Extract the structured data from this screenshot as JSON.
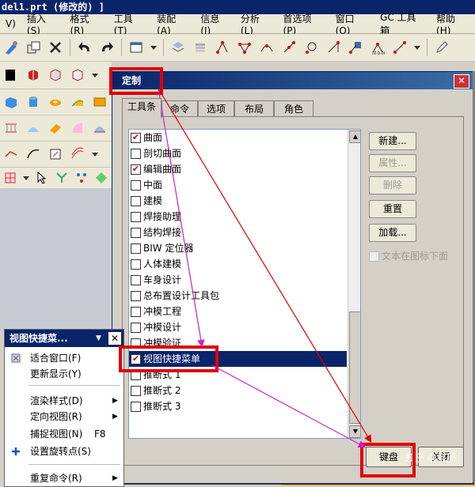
{
  "window": {
    "title": "del1.prt  (修改的) ]"
  },
  "menu": [
    "V)",
    "插入(S)",
    "格式(R)",
    "工具(T)",
    "装配(A)",
    "信息(I)",
    "分析(L)",
    "首选项(P)",
    "窗口(O)",
    "GC 工具箱",
    "帮助(H)"
  ],
  "dialog": {
    "title": "定制",
    "close_label": "✕",
    "tabs": [
      "工具条",
      "命令",
      "选项",
      "布局",
      "角色"
    ],
    "items": [
      {
        "label": "曲面",
        "checked": true
      },
      {
        "label": "剖切曲面",
        "checked": false
      },
      {
        "label": "编辑曲面",
        "checked": true
      },
      {
        "label": "中面",
        "checked": false
      },
      {
        "label": "建模",
        "checked": false
      },
      {
        "label": "焊接助理",
        "checked": false
      },
      {
        "label": "结构焊接",
        "checked": false
      },
      {
        "label": "BIW 定位器",
        "checked": false
      },
      {
        "label": "人体建模",
        "checked": false
      },
      {
        "label": "车身设计",
        "checked": false
      },
      {
        "label": "总布置设计工具包",
        "checked": false
      },
      {
        "label": "冲模工程",
        "checked": false
      },
      {
        "label": "冲模设计",
        "checked": false
      },
      {
        "label": "冲模验证",
        "checked": false
      },
      {
        "label": "视图快捷菜单",
        "checked": true,
        "selected": true
      },
      {
        "label": "推断式 1",
        "checked": false
      },
      {
        "label": "推断式 2",
        "checked": false
      },
      {
        "label": "推断式 3",
        "checked": false
      }
    ],
    "buttons": {
      "new": "新建...",
      "properties": "属性...",
      "delete": "删除",
      "reset": "重置",
      "load": "加载..."
    },
    "text_below_icon": "文本在图标下面",
    "build": "键盘",
    "close": "关闭"
  },
  "popup": {
    "title": "视图快捷菜...",
    "close_label": "✕",
    "items": [
      {
        "label": "适合窗口(F)",
        "shortcut": "",
        "arrow": false,
        "icon": "fit-icon"
      },
      {
        "label": "更新显示(Y)",
        "shortcut": "",
        "arrow": false,
        "icon": ""
      },
      {
        "label": "渲染样式(D)",
        "shortcut": "",
        "arrow": true,
        "icon": ""
      },
      {
        "label": "定向视图(R)",
        "shortcut": "",
        "arrow": true,
        "icon": ""
      },
      {
        "label": "捕捉视图(N)",
        "shortcut": "F8",
        "arrow": false,
        "icon": ""
      },
      {
        "label": "设置旋转点(S)",
        "shortcut": "",
        "arrow": false,
        "icon": "plus-icon"
      },
      {
        "label": "重复命令(R)",
        "shortcut": "",
        "arrow": true,
        "icon": ""
      }
    ]
  },
  "watermark": "知乎 @科颜",
  "colors": {
    "highlight": "#e00000",
    "arrow": "#d020c0",
    "selection": "#0a246a"
  }
}
